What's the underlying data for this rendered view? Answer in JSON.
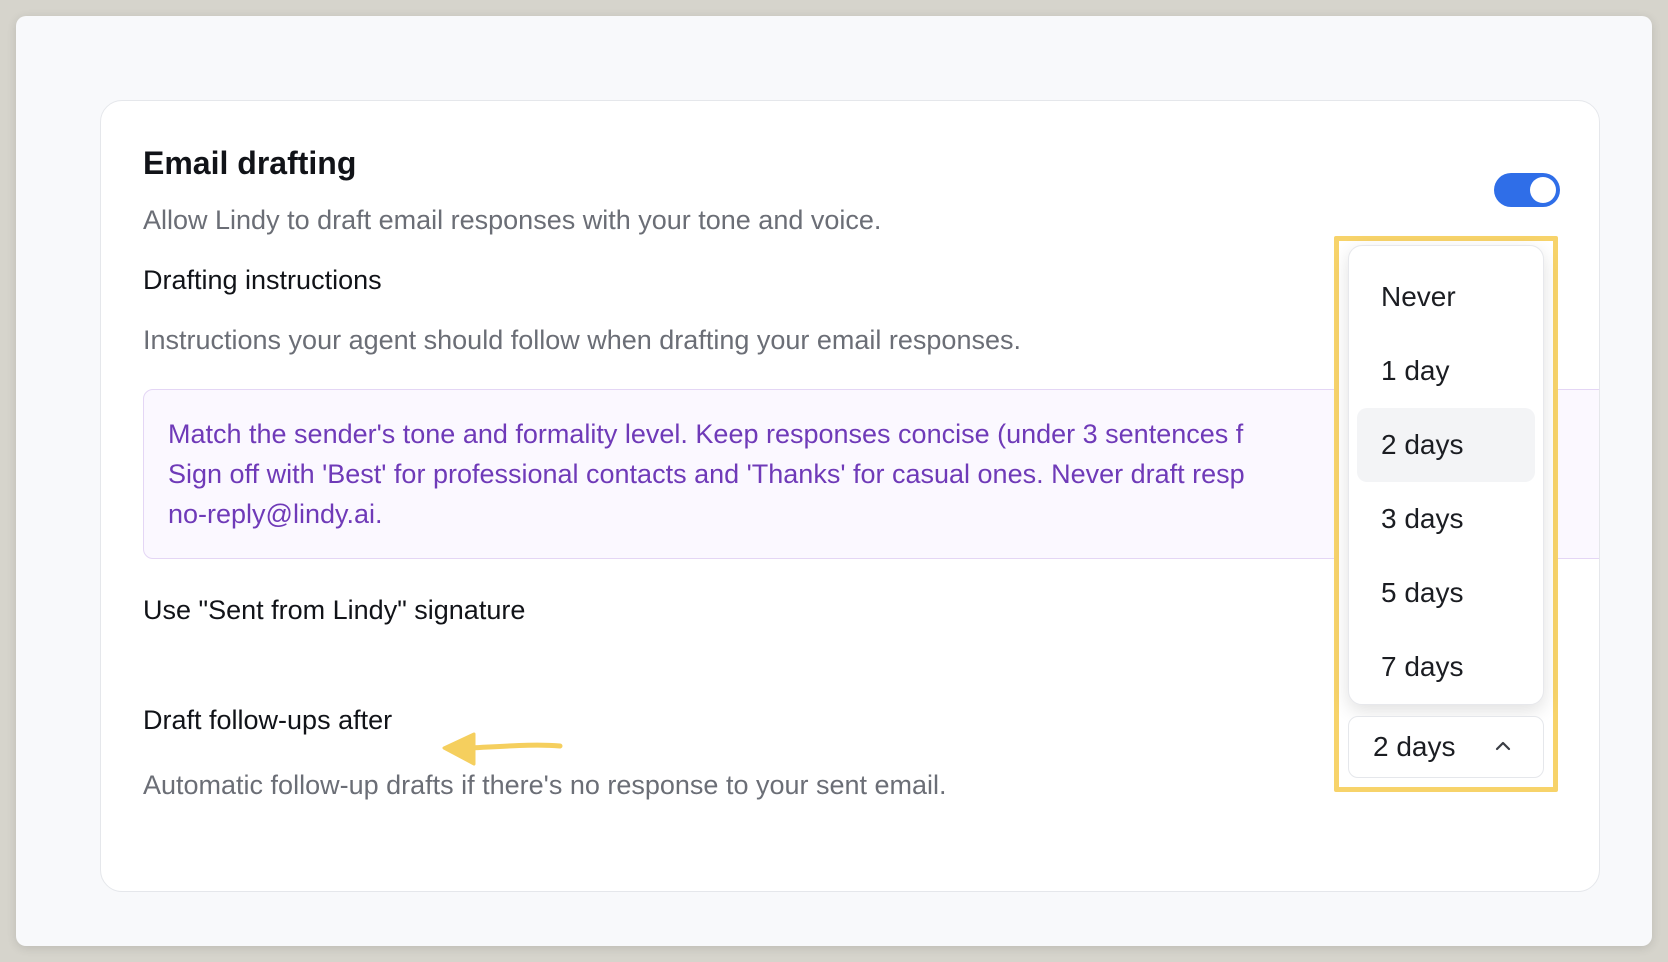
{
  "email_drafting": {
    "title": "Email drafting",
    "description": "Allow Lindy to draft email responses with your tone and voice.",
    "enabled": true
  },
  "drafting_instructions": {
    "label": "Drafting instructions",
    "description": "Instructions your agent should follow when drafting your email responses.",
    "lines": [
      "Match the sender's tone and formality level. Keep responses concise (under 3 sentences f",
      "Sign off with 'Best' for professional contacts and 'Thanks' for casual ones. Never draft resp",
      "no-reply@lindy.ai."
    ]
  },
  "signature": {
    "label": "Use \"Sent from Lindy\" signature"
  },
  "follow_ups": {
    "label": "Draft follow-ups after",
    "description": "Automatic follow-up drafts if there's no response to your sent email.",
    "selected_value": "2 days",
    "options": [
      "Never",
      "1 day",
      "2 days",
      "3 days",
      "5 days",
      "7 days"
    ],
    "selected_index": 2
  },
  "icons": {
    "chevron": "chevron-up-icon",
    "arrow": "arrow-left-icon"
  },
  "colors": {
    "accent": "#2f6ee8",
    "highlight": "#f7d36a",
    "instruction_text": "#6f3ab8"
  }
}
